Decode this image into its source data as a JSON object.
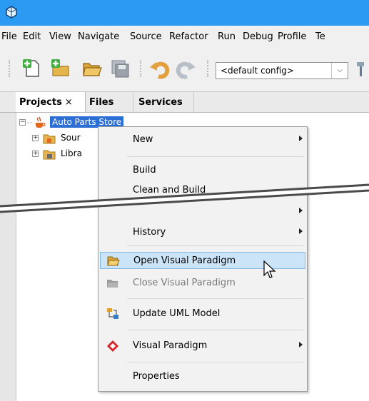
{
  "menubar": {
    "items": [
      "File",
      "Edit",
      "View",
      "Navigate",
      "Source",
      "Refactor",
      "Run",
      "Debug",
      "Profile",
      "Te"
    ]
  },
  "toolbar": {
    "config_value": "<default config>"
  },
  "tabs": {
    "projects": "Projects",
    "close": "×",
    "files": "Files",
    "services": "Services"
  },
  "tree": {
    "root": "Auto Parts Store",
    "children": [
      "Sour",
      "Libra"
    ]
  },
  "context_menu": {
    "new": "New",
    "build": "Build",
    "clean_and_build": "Clean and Build",
    "history": "History",
    "open_vp": "Open Visual Paradigm",
    "close_vp": "Close Visual Paradigm",
    "update_uml": "Update UML Model",
    "visual_paradigm": "Visual Paradigm",
    "properties": "Properties"
  },
  "colors": {
    "titlebar": "#2b9af3",
    "selection": "#2b6fd6",
    "menu_hover": "#cce4f7"
  }
}
